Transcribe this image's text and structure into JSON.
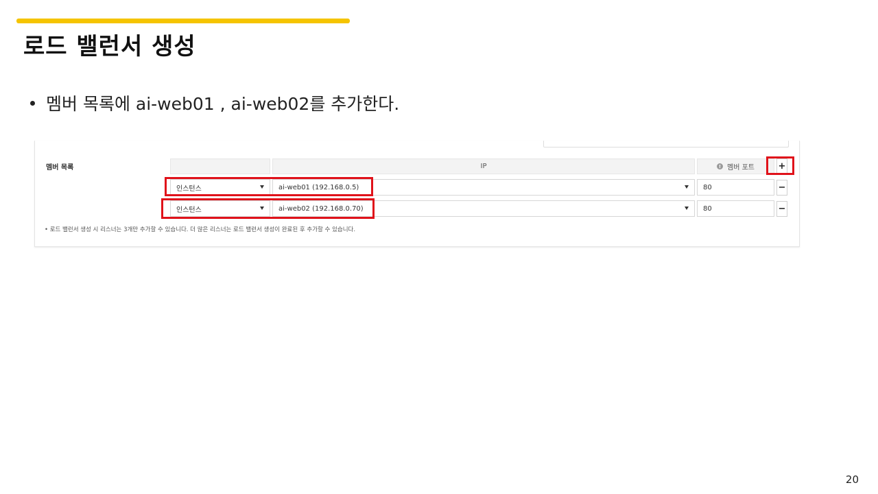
{
  "slide": {
    "title": "로드 밸런서 생성",
    "bullet": "멤버 목록에 ai-web01 , ai-web02를 추가한다.",
    "page_number": "20"
  },
  "member_list": {
    "label": "멤버 목록",
    "columns": {
      "type": "",
      "ip": "IP",
      "port": "멤버 포트"
    },
    "add_button": "+",
    "remove_button": "−",
    "rows": [
      {
        "type": "인스턴스",
        "ip": "ai-web01 (192.168.0.5)",
        "port": "80"
      },
      {
        "type": "인스턴스",
        "ip": "ai-web02 (192.168.0.70)",
        "port": "80"
      }
    ],
    "note": "• 로드 밸런서 생성 시 리스너는 3개만 추가할 수 있습니다. 더 많은 리스너는 로드 밸런서 생성이 완료된 후 추가할 수 있습니다."
  },
  "colors": {
    "accent": "#f5c400",
    "highlight": "#e0121a"
  }
}
